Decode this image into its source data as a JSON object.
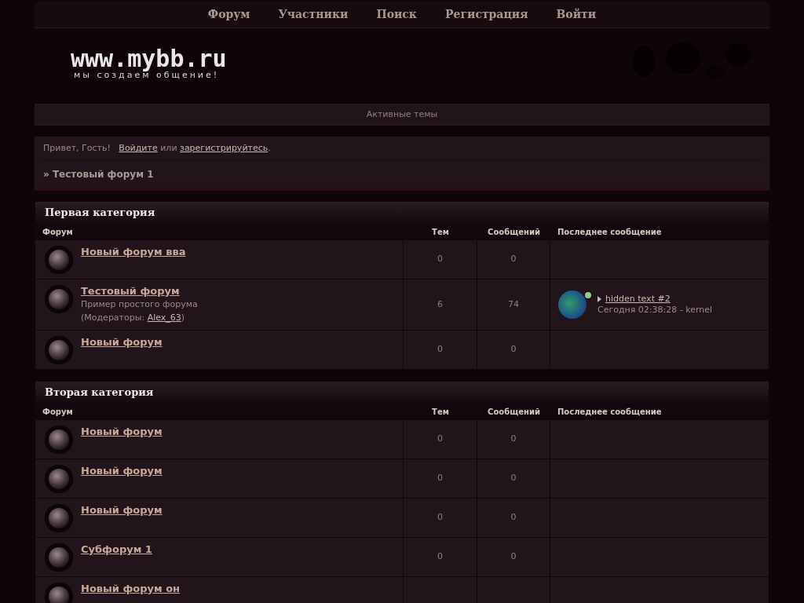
{
  "nav": [
    {
      "label": "Форум"
    },
    {
      "label": "Участники"
    },
    {
      "label": "Поиск"
    },
    {
      "label": "Регистрация"
    },
    {
      "label": "Войти"
    }
  ],
  "logo": {
    "title": "www.mybb.ru",
    "tagline": "мы создаем общение!"
  },
  "active_topics": "Активные темы",
  "welcome": {
    "greeting": "Привет, Гость!",
    "login": "Войдите",
    "joiner": "или",
    "register": "зарегистрируйтесь",
    "end": "."
  },
  "breadcrumb": "» Тестовый форум 1",
  "categories": [
    {
      "title": "Первая категория",
      "columns": [
        "Форум",
        "Тем",
        "Сообщений",
        "Последнее сообщение"
      ],
      "forums": [
        {
          "name": "Новый форум вва",
          "topics": "0",
          "posts": "0"
        },
        {
          "name": "Тестовый форум",
          "description": "Пример простого форума",
          "moderators_prefix": "(Модераторы: ",
          "moderator": "Alex_63",
          "moderators_suffix": ")",
          "topics": "6",
          "posts": "74",
          "last_post": {
            "title": "hidden text #2",
            "meta": "Сегодня 02:38:28 - kernel",
            "online": true
          }
        },
        {
          "name": "Новый форум",
          "topics": "0",
          "posts": "0"
        }
      ]
    },
    {
      "title": "Вторая категория",
      "columns": [
        "Форум",
        "Тем",
        "Сообщений",
        "Последнее сообщение"
      ],
      "forums": [
        {
          "name": "Новый форум",
          "topics": "0",
          "posts": "0"
        },
        {
          "name": "Новый форум",
          "topics": "0",
          "posts": "0"
        },
        {
          "name": "Новый форум",
          "topics": "0",
          "posts": "0"
        },
        {
          "name": "Субфорум 1",
          "topics": "0",
          "posts": "0"
        },
        {
          "name": "Новый форум он"
        }
      ]
    }
  ]
}
